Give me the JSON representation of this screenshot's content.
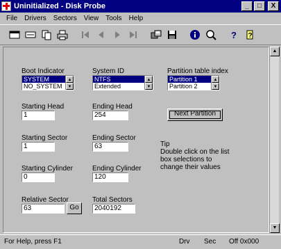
{
  "window": {
    "title": "Uninitialized - Disk Probe"
  },
  "title_buttons": {
    "minimize": "_",
    "maximize": "□",
    "close": "X"
  },
  "menu": [
    "File",
    "Drivers",
    "Sectors",
    "View",
    "Tools",
    "Help"
  ],
  "form": {
    "boot_indicator": {
      "label": "Boot Indicator",
      "options": [
        "SYSTEM",
        "NO_SYSTEM"
      ],
      "selected": "SYSTEM"
    },
    "system_id": {
      "label": "System ID",
      "options": [
        "NTFS",
        "Extended"
      ],
      "selected": "NTFS"
    },
    "partition_index": {
      "label": "Partition table index",
      "options": [
        "Partition 1",
        "Partition 2"
      ],
      "selected": "Partition 1"
    },
    "starting_head": {
      "label": "Starting Head",
      "value": "1"
    },
    "ending_head": {
      "label": "Ending Head",
      "value": "254"
    },
    "next_partition": {
      "label": "Next Partition"
    },
    "starting_sector": {
      "label": "Starting Sector",
      "value": "1"
    },
    "ending_sector": {
      "label": "Ending Sector",
      "value": "63"
    },
    "tip": {
      "title": "Tip",
      "text_1": "Double click on the list",
      "text_2": "box selections to",
      "text_3": "change their values"
    },
    "starting_cylinder": {
      "label": "Starting Cylinder",
      "value": "0"
    },
    "ending_cylinder": {
      "label": "Ending Cylinder",
      "value": "120"
    },
    "relative_sector": {
      "label": "Relative Sector",
      "value": "63",
      "go_label": "Go"
    },
    "total_sectors": {
      "label": "Total Sectors",
      "value": "2040192"
    }
  },
  "status": {
    "help": "For Help, press F1",
    "drive": "Drv",
    "sector": "Sec",
    "offset": "Off 0x000"
  },
  "scroll": {
    "up": "▲",
    "down": "▼"
  }
}
